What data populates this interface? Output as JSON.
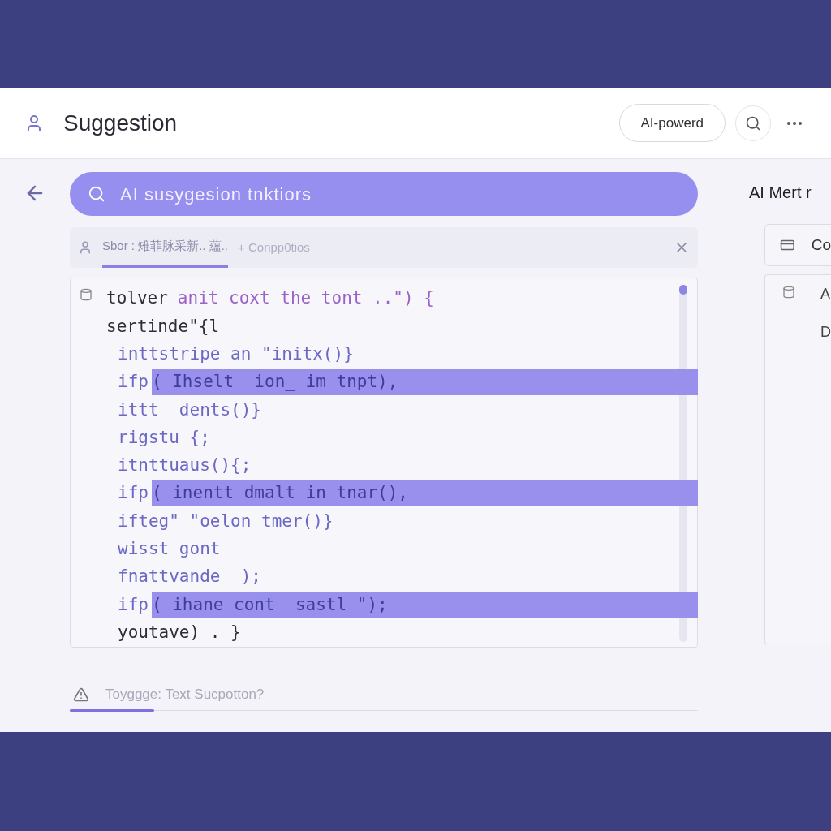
{
  "header": {
    "title": "Suggestion",
    "badge": "AI-powerd"
  },
  "search": {
    "value": "AI susygesion tnktiors"
  },
  "side_title": "AI Mert r",
  "tabs": [
    {
      "label": "Sbor : 雉菲脉采新..  蘊..",
      "selected": true
    },
    {
      "label": "+ Conpp0tios",
      "selected": false
    }
  ],
  "code_lines": [
    {
      "kind": "outer",
      "text": "tolver",
      "rest": "anit coxt the tont ..\") {"
    },
    {
      "kind": "outer",
      "text": "sertinde\"{l"
    },
    {
      "kind": "inner",
      "text": "inttstripe an \"initx()}"
    },
    {
      "kind": "highlight",
      "text": "ifp",
      "selection": "( Ihselt  ion_ im tnpt),"
    },
    {
      "kind": "inner",
      "text": "ittt  dents()}"
    },
    {
      "kind": "inner",
      "text": "rigstu {;"
    },
    {
      "kind": "inner",
      "text": "itnttuaus(){;"
    },
    {
      "kind": "highlight",
      "text": "ifp",
      "selection": "( inentt dmalt in tnar(),"
    },
    {
      "kind": "inner",
      "text": "ifteg\" \"oelon tmer()}"
    },
    {
      "kind": "inner",
      "text": "wisst gont"
    },
    {
      "kind": "inner",
      "text": "fnattvande  );"
    },
    {
      "kind": "highlight",
      "text": "ifp",
      "selection": "( ihane cont  sastl \");"
    },
    {
      "kind": "outer2",
      "text": "youtave) . }"
    }
  ],
  "side_card": {
    "label": "Co",
    "lines": [
      "A",
      "D"
    ]
  },
  "footer": {
    "hint": "Toyggge: Text Sucpotton?"
  }
}
